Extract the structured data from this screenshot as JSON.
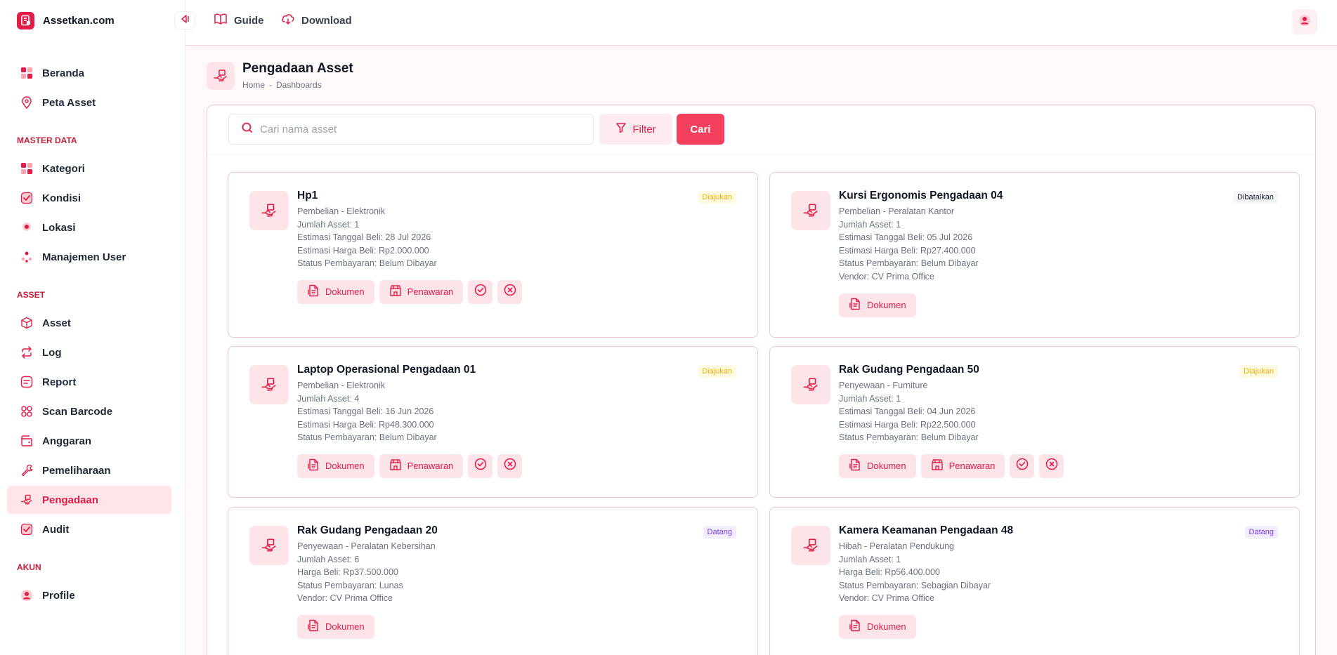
{
  "app": {
    "name": "Assetkan.com"
  },
  "header": {
    "guide_label": "Guide",
    "download_label": "Download"
  },
  "sidebar": {
    "top_items": [
      {
        "label": "Beranda",
        "icon": "grid-icon"
      },
      {
        "label": "Peta Asset",
        "icon": "map-pin-icon"
      }
    ],
    "sections": [
      {
        "title": "MASTER DATA",
        "items": [
          {
            "label": "Kategori",
            "icon": "grid-icon"
          },
          {
            "label": "Kondisi",
            "icon": "check-square-icon"
          },
          {
            "label": "Lokasi",
            "icon": "location-dot-icon"
          },
          {
            "label": "Manajemen User",
            "icon": "users-icon"
          }
        ]
      },
      {
        "title": "ASSET",
        "items": [
          {
            "label": "Asset",
            "icon": "cube-icon"
          },
          {
            "label": "Log",
            "icon": "repeat-icon"
          },
          {
            "label": "Report",
            "icon": "report-icon"
          },
          {
            "label": "Scan Barcode",
            "icon": "scan-icon"
          },
          {
            "label": "Anggaran",
            "icon": "wallet-icon"
          },
          {
            "label": "Pemeliharaan",
            "icon": "wrench-icon"
          },
          {
            "label": "Pengadaan",
            "icon": "hand-box-icon",
            "active": true
          },
          {
            "label": "Audit",
            "icon": "check-square-icon"
          }
        ]
      },
      {
        "title": "AKUN",
        "items": [
          {
            "label": "Profile",
            "icon": "user-circle-icon"
          }
        ]
      }
    ]
  },
  "page": {
    "title": "Pengadaan Asset",
    "breadcrumb": [
      "Home",
      "-",
      "Dashboards"
    ]
  },
  "search": {
    "placeholder": "Cari nama asset",
    "value": ""
  },
  "toolbar": {
    "filter_label": "Filter",
    "search_button": "Cari"
  },
  "labels": {
    "dokumen": "Dokumen",
    "penawaran": "Penawaran"
  },
  "colors": {
    "accent": "#e11d48",
    "accent_soft": "#fde4e8",
    "cari_button": "#f43f5e"
  },
  "cards": [
    {
      "title": "Hp1",
      "status": "Diajukan",
      "status_type": "diajukan",
      "lines": [
        "Pembelian - Elektronik",
        "Jumlah Asset: 1",
        "Estimasi Tanggal Beli: 28 Jul 2026",
        "Estimasi Harga Beli: Rp2.000.000",
        "Status Pembayaran: Belum Dibayar"
      ],
      "actions": [
        "dokumen",
        "penawaran",
        "approve",
        "reject"
      ]
    },
    {
      "title": "Kursi Ergonomis Pengadaan 04",
      "status": "Dibatalkan",
      "status_type": "dibatalkan",
      "lines": [
        "Pembelian - Peralatan Kantor",
        "Jumlah Asset: 1",
        "Estimasi Tanggal Beli: 05 Jul 2026",
        "Estimasi Harga Beli: Rp27.400.000",
        "Status Pembayaran: Belum Dibayar",
        "Vendor: CV Prima Office"
      ],
      "actions": [
        "dokumen"
      ]
    },
    {
      "title": "Laptop Operasional Pengadaan 01",
      "status": "Diajukan",
      "status_type": "diajukan",
      "lines": [
        "Pembelian - Elektronik",
        "Jumlah Asset: 4",
        "Estimasi Tanggal Beli: 16 Jun 2026",
        "Estimasi Harga Beli: Rp48.300.000",
        "Status Pembayaran: Belum Dibayar"
      ],
      "actions": [
        "dokumen",
        "penawaran",
        "approve",
        "reject"
      ]
    },
    {
      "title": "Rak Gudang Pengadaan 50",
      "status": "Diajukan",
      "status_type": "diajukan",
      "lines": [
        "Penyewaan - Furniture",
        "Jumlah Asset: 1",
        "Estimasi Tanggal Beli: 04 Jun 2026",
        "Estimasi Harga Beli: Rp22.500.000",
        "Status Pembayaran: Belum Dibayar"
      ],
      "actions": [
        "dokumen",
        "penawaran",
        "approve",
        "reject"
      ]
    },
    {
      "title": "Rak Gudang Pengadaan 20",
      "status": "Datang",
      "status_type": "datang",
      "lines": [
        "Penyewaan - Peralatan Kebersihan",
        "Jumlah Asset: 6",
        "Harga Beli: Rp37.500.000",
        "Status Pembayaran: Lunas",
        "Vendor: CV Prima Office"
      ],
      "actions": [
        "dokumen"
      ]
    },
    {
      "title": "Kamera Keamanan Pengadaan 48",
      "status": "Datang",
      "status_type": "datang",
      "lines": [
        "Hibah - Peralatan Pendukung",
        "Jumlah Asset: 1",
        "Harga Beli: Rp56.400.000",
        "Status Pembayaran: Sebagian Dibayar",
        "Vendor: CV Prima Office"
      ],
      "actions": [
        "dokumen"
      ]
    }
  ]
}
